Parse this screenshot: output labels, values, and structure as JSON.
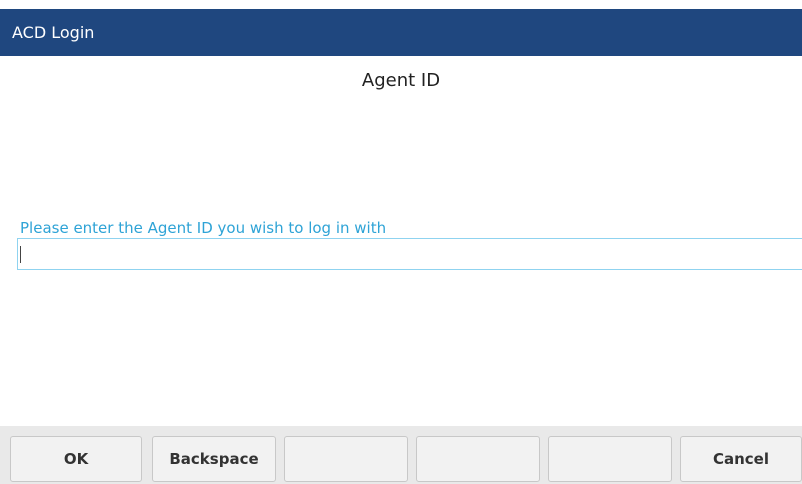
{
  "window": {
    "title": "ACD Login"
  },
  "main": {
    "heading": "Agent ID",
    "field_label": "Please enter the Agent ID you wish to log in with",
    "input_value": ""
  },
  "softkeys": [
    {
      "label": "OK"
    },
    {
      "label": "Backspace"
    },
    {
      "label": ""
    },
    {
      "label": ""
    },
    {
      "label": ""
    },
    {
      "label": "Cancel"
    }
  ],
  "colors": {
    "title_bar": "#1f477f",
    "label_text": "#2ea3d6",
    "input_border": "#8fd3f0",
    "softkey_bar": "#e9e9e9"
  }
}
